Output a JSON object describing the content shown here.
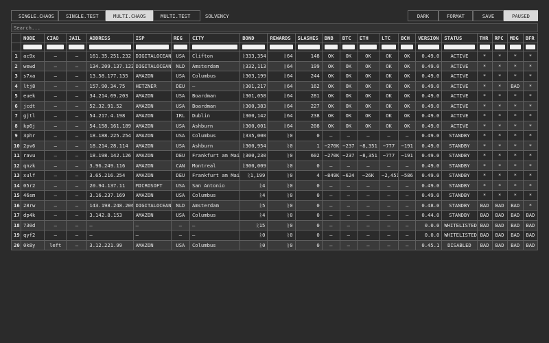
{
  "tabs": [
    "SINGLE.CHAOS",
    "SINGLE.TEST",
    "MULTI.CHAOS",
    "MULTI.TEST"
  ],
  "active_tab": 2,
  "solvency_label": "SOLVENCY",
  "right_buttons": [
    "DARK",
    "FORMAT",
    "SAVE",
    "PAUSED"
  ],
  "search_placeholder": "Search...",
  "columns": [
    "",
    "NODE",
    "CIAO",
    "JAIL",
    "ADDRESS",
    "ISP",
    "REG",
    "CITY",
    "BOND",
    "REWARDS",
    "SLASHES",
    "BNB",
    "BTC",
    "ETH",
    "LTC",
    "BCH",
    "VERSION",
    "STATUS",
    "THR",
    "RPC",
    "MDG",
    "BFR"
  ],
  "rows": [
    [
      "1",
      "ac9x",
      "–",
      "–",
      "161.35.251.232",
      "DIGITALOCEAN",
      "USA",
      "Clifton",
      "ᚱ333,354",
      "ᚱ64",
      "148",
      "OK",
      "OK",
      "OK",
      "OK",
      "OK",
      "0.49.0",
      "ACTIVE",
      "*",
      "*",
      "*",
      "*"
    ],
    [
      "2",
      "wewd",
      "–",
      "–",
      "134.209.137.123",
      "DIGITALOCEAN",
      "NLD",
      "Amsterdam",
      "ᚱ332,113",
      "ᚱ64",
      "199",
      "OK",
      "OK",
      "OK",
      "OK",
      "OK",
      "0.49.0",
      "ACTIVE",
      "*",
      "*",
      "*",
      "*"
    ],
    [
      "3",
      "s7xa",
      "–",
      "–",
      "13.58.177.135",
      "AMAZON",
      "USA",
      "Columbus",
      "ᚱ303,199",
      "ᚱ64",
      "244",
      "OK",
      "OK",
      "OK",
      "OK",
      "OK",
      "0.49.0",
      "ACTIVE",
      "*",
      "*",
      "*",
      "*"
    ],
    [
      "4",
      "ltj8",
      "–",
      "–",
      "157.90.34.75",
      "HETZNER",
      "DEU",
      "–",
      "ᚱ301,217",
      "ᚱ64",
      "162",
      "OK",
      "OK",
      "OK",
      "OK",
      "OK",
      "0.49.0",
      "ACTIVE",
      "*",
      "*",
      "BAD",
      "*"
    ],
    [
      "5",
      "euek",
      "–",
      "–",
      "34.214.69.203",
      "AMAZON",
      "USA",
      "Boardman",
      "ᚱ301,058",
      "ᚱ64",
      "281",
      "OK",
      "OK",
      "OK",
      "OK",
      "OK",
      "0.49.0",
      "ACTIVE",
      "*",
      "*",
      "*",
      "*"
    ],
    [
      "6",
      "jcdt",
      "–",
      "–",
      "52.32.91.52",
      "AMAZON",
      "USA",
      "Boardman",
      "ᚱ300,383",
      "ᚱ64",
      "227",
      "OK",
      "OK",
      "OK",
      "OK",
      "OK",
      "0.49.0",
      "ACTIVE",
      "*",
      "*",
      "*",
      "*"
    ],
    [
      "7",
      "gjtl",
      "–",
      "–",
      "54.217.4.198",
      "AMAZON",
      "IRL",
      "Dublin",
      "ᚱ300,142",
      "ᚱ64",
      "238",
      "OK",
      "OK",
      "OK",
      "OK",
      "OK",
      "0.49.0",
      "ACTIVE",
      "*",
      "*",
      "*",
      "*"
    ],
    [
      "8",
      "kp6j",
      "–",
      "–",
      "54.158.161.189",
      "AMAZON",
      "USA",
      "Ashburn",
      "ᚱ300,001",
      "ᚱ64",
      "208",
      "OK",
      "OK",
      "OK",
      "OK",
      "OK",
      "0.49.0",
      "ACTIVE",
      "*",
      "*",
      "*",
      "*"
    ],
    [
      "9",
      "3phr",
      "–",
      "–",
      "18.188.225.254",
      "AMAZON",
      "USA",
      "Columbus",
      "ᚱ335,000",
      "ᚱ0",
      "0",
      "–",
      "–",
      "–",
      "–",
      "–",
      "0.49.0",
      "STANDBY",
      "*",
      "*",
      "*",
      "*"
    ],
    [
      "10",
      "2pv6",
      "–",
      "–",
      "18.214.28.114",
      "AMAZON",
      "USA",
      "Ashburn",
      "ᚱ300,954",
      "ᚱ0",
      "1",
      "−270K",
      "−237",
      "−8,351",
      "−777",
      "−191",
      "0.49.0",
      "STANDBY",
      "*",
      "*",
      "*",
      "*"
    ],
    [
      "11",
      "ravu",
      "–",
      "–",
      "18.198.142.126",
      "AMAZON",
      "DEU",
      "Frankfurt am Main",
      "ᚱ300,230",
      "ᚱ0",
      "602",
      "−270K",
      "−237",
      "−8,351",
      "−777",
      "−191",
      "0.49.0",
      "STANDBY",
      "*",
      "*",
      "*",
      "*"
    ],
    [
      "12",
      "qnzk",
      "–",
      "–",
      "3.96.249.116",
      "AMAZON",
      "CAN",
      "Montreal",
      "ᚱ300,009",
      "ᚱ0",
      "0",
      "–",
      "–",
      "–",
      "–",
      "–",
      "0.49.0",
      "STANDBY",
      "*",
      "*",
      "*",
      "*"
    ],
    [
      "13",
      "xulf",
      "–",
      "–",
      "3.65.216.254",
      "AMAZON",
      "DEU",
      "Frankfurt am Main",
      "ᚱ1,199",
      "ᚱ0",
      "4",
      "−849K",
      "−624",
      "−26K",
      "−2,451",
      "−586",
      "0.49.0",
      "STANDBY",
      "*",
      "*",
      "*",
      "*"
    ],
    [
      "14",
      "05r2",
      "–",
      "–",
      "20.94.137.11",
      "MICROSOFT",
      "USA",
      "San Antonio",
      "ᚱ4",
      "ᚱ0",
      "0",
      "–",
      "–",
      "–",
      "–",
      "–",
      "0.49.0",
      "STANDBY",
      "*",
      "*",
      "*",
      "*"
    ],
    [
      "15",
      "46sm",
      "–",
      "–",
      "3.16.237.169",
      "AMAZON",
      "USA",
      "Columbus",
      "ᚱ4",
      "ᚱ0",
      "0",
      "–",
      "–",
      "–",
      "–",
      "–",
      "0.49.0",
      "STANDBY",
      "*",
      "*",
      "*",
      "*"
    ],
    [
      "16",
      "28rw",
      "–",
      "–",
      "143.198.248.206",
      "DIGITALOCEAN",
      "NLD",
      "Amsterdam",
      "ᚱ5",
      "ᚱ0",
      "0",
      "–",
      "–",
      "–",
      "–",
      "–",
      "0.48.0",
      "STANDBY",
      "BAD",
      "BAD",
      "BAD",
      "*"
    ],
    [
      "17",
      "dp4k",
      "–",
      "–",
      "3.142.8.153",
      "AMAZON",
      "USA",
      "Columbus",
      "ᚱ4",
      "ᚱ0",
      "0",
      "–",
      "–",
      "–",
      "–",
      "–",
      "0.44.0",
      "STANDBY",
      "BAD",
      "BAD",
      "BAD",
      "BAD"
    ],
    [
      "18",
      "730d",
      "–",
      "–",
      "–",
      "–",
      "–",
      "–",
      "ᚱ15",
      "ᚱ0",
      "0",
      "–",
      "–",
      "–",
      "–",
      "–",
      "0.0.0",
      "WHITELISTED",
      "BAD",
      "BAD",
      "BAD",
      "BAD"
    ],
    [
      "19",
      "qyf2",
      "–",
      "–",
      "–",
      "–",
      "–",
      "–",
      "ᚱ0",
      "ᚱ0",
      "0",
      "–",
      "–",
      "–",
      "–",
      "–",
      "0.0.0",
      "WHITELISTED",
      "BAD",
      "BAD",
      "BAD",
      "BAD"
    ],
    [
      "20",
      "0k8y",
      "left",
      "–",
      "3.12.221.99",
      "AMAZON",
      "USA",
      "Columbus",
      "ᚱ0",
      "ᚱ0",
      "0",
      "–",
      "–",
      "–",
      "–",
      "–",
      "0.45.1",
      "DISABLED",
      "BAD",
      "BAD",
      "BAD",
      "BAD"
    ]
  ]
}
